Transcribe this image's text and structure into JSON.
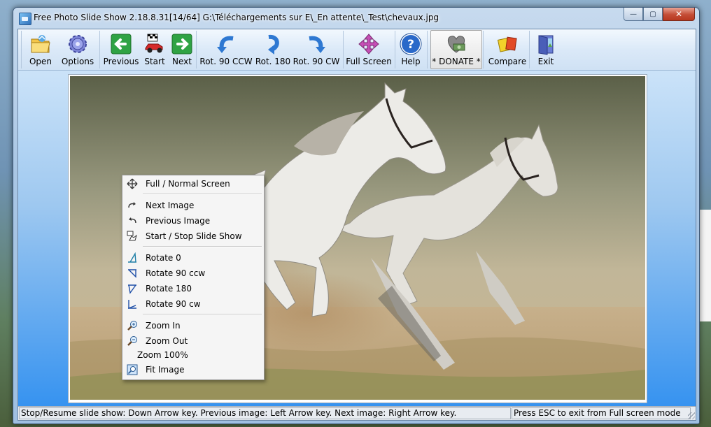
{
  "window": {
    "title": "Free Photo Slide Show 2.18.8.31[14/64] G:\\Téléchargements sur E\\_En attente\\_Test\\chevaux.jpg",
    "buttons": {
      "minimize": "—",
      "maximize": "▢",
      "close": "✕"
    }
  },
  "toolbar": {
    "open": "Open",
    "options": "Options",
    "previous": "Previous",
    "start": "Start",
    "next": "Next",
    "rot_ccw": "Rot. 90 CCW",
    "rot_180": "Rot. 180",
    "rot_cw": "Rot. 90 CW",
    "full_screen": "Full Screen",
    "help": "Help",
    "donate": "* DONATE *",
    "compare": "Compare",
    "exit": "Exit"
  },
  "context_menu": {
    "items": [
      "Full / Normal Screen",
      "Next Image",
      "Previous Image",
      "Start / Stop Slide Show",
      "Rotate 0",
      "Rotate 90 ccw",
      "Rotate 180",
      "Rotate 90 cw",
      "Zoom In",
      "Zoom Out",
      "Zoom 100%",
      "Fit Image"
    ]
  },
  "statusbar": {
    "left": "Stop/Resume slide show: Down Arrow key. Previous image: Left Arrow key. Next image: Right Arrow key.",
    "right": "Press ESC to exit from Full screen mode"
  },
  "colors": {
    "accent_green": "#2fa344",
    "accent_blue": "#2e78d2",
    "toolbar_bg": "#dbe9f8"
  }
}
